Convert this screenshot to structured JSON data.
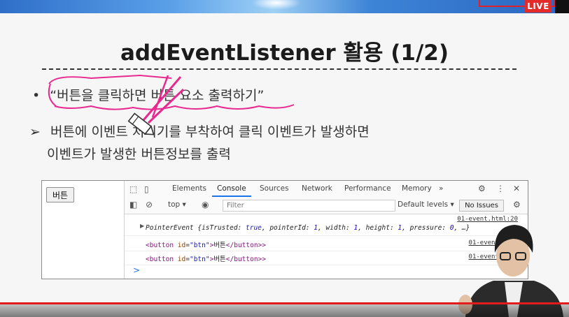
{
  "stream": {
    "live_label": "LIVE"
  },
  "slide": {
    "title": "addEventListener 활용 (1/2)",
    "bullet1_mark": "•",
    "bullet1": "“버튼을 클릭하면 버튼 요소 출력하기”",
    "bullet2_mark": "➢",
    "bullet2_line1": "버튼에 이벤트 처리기를 부착하여 클릭 이벤트가 발생하면",
    "bullet2_line2": "이벤트가 발생한 버튼정보를 출력"
  },
  "demo": {
    "button_label": "버튼"
  },
  "devtools": {
    "tabs": [
      "Elements",
      "Console",
      "Sources",
      "Network",
      "Performance",
      "Memory"
    ],
    "more_tabs": "»",
    "active_tab": "Console",
    "context": "top ▾",
    "filter_placeholder": "Filter",
    "levels": "Default levels ▾",
    "issues": "No Issues",
    "logs": [
      {
        "source": "01-event.html:20"
      },
      {
        "source": "01-event.html"
      },
      {
        "source": "01-event.html"
      }
    ],
    "pointer_event": {
      "name": "PointerEvent",
      "isTrusted": "true",
      "pointerId": "1",
      "width": "1",
      "height": "1",
      "pressure": "0"
    },
    "button_html": {
      "tag_open": "<button",
      "attr": "id",
      "value": "\"btn\"",
      "text": "버튼",
      "tag_close": "</button>"
    },
    "prompt": ">"
  },
  "colors": {
    "accent": "#1a73e8",
    "live": "#e52a2a",
    "annotation": "#e8298f"
  }
}
